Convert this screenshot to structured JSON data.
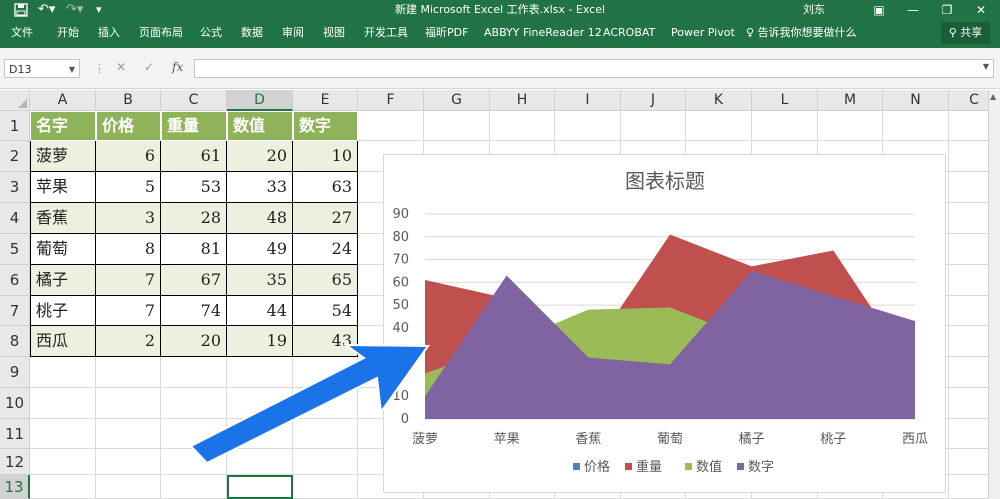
{
  "window": {
    "title": "新建 Microsoft Excel 工作表.xlsx  -  Excel",
    "user": "刘东",
    "save_icon": "save-icon",
    "undo_icon": "undo-icon",
    "redo_icon": "redo-icon",
    "minimize": "—",
    "restore": "❐",
    "close": "✕"
  },
  "ribbon": {
    "tabs": [
      "文件",
      "开始",
      "插入",
      "页面布局",
      "公式",
      "数据",
      "审阅",
      "视图",
      "开发工具",
      "福昕PDF",
      "ABBYY FineReader 12",
      "ACROBAT",
      "Power Pivot"
    ],
    "tell_me": "告诉我你想要做什么",
    "share": "共享"
  },
  "formula_bar": {
    "name_box": "D13",
    "cancel": "✕",
    "enter": "✓",
    "fx": "fx",
    "value": ""
  },
  "columns": [
    "A",
    "B",
    "C",
    "D",
    "E",
    "F",
    "G",
    "H",
    "I",
    "J",
    "K",
    "L",
    "M",
    "N",
    "C"
  ],
  "rows": [
    "1",
    "2",
    "3",
    "4",
    "5",
    "6",
    "7",
    "8",
    "9",
    "10",
    "11",
    "12",
    "13"
  ],
  "table": {
    "headers": [
      "名字",
      "价格",
      "重量",
      "数值",
      "数字"
    ],
    "rows": [
      [
        "菠萝",
        "6",
        "61",
        "20",
        "10"
      ],
      [
        "苹果",
        "5",
        "53",
        "33",
        "63"
      ],
      [
        "香蕉",
        "3",
        "28",
        "48",
        "27"
      ],
      [
        "葡萄",
        "8",
        "81",
        "49",
        "24"
      ],
      [
        "橘子",
        "7",
        "67",
        "35",
        "65"
      ],
      [
        "桃子",
        "7",
        "74",
        "44",
        "54"
      ],
      [
        "西瓜",
        "2",
        "20",
        "19",
        "43"
      ]
    ]
  },
  "chart_data": {
    "type": "area",
    "title": "图表标题",
    "categories": [
      "菠萝",
      "苹果",
      "香蕉",
      "葡萄",
      "橘子",
      "桃子",
      "西瓜"
    ],
    "ylim": [
      0,
      90
    ],
    "yticks": [
      0,
      10,
      20,
      30,
      40,
      50,
      60,
      70,
      80,
      90
    ],
    "grid": true,
    "legend_position": "bottom",
    "series": [
      {
        "name": "价格",
        "color": "#4f81bd",
        "values": [
          6,
          5,
          3,
          8,
          7,
          7,
          2
        ]
      },
      {
        "name": "重量",
        "color": "#c0504d",
        "values": [
          61,
          53,
          28,
          81,
          67,
          74,
          20
        ]
      },
      {
        "name": "数值",
        "color": "#9bbb59",
        "values": [
          20,
          33,
          48,
          49,
          35,
          44,
          19
        ]
      },
      {
        "name": "数字",
        "color": "#8064a2",
        "values": [
          10,
          63,
          27,
          24,
          65,
          54,
          43
        ]
      }
    ]
  },
  "colors": {
    "excel_green": "#217346",
    "header_fill": "#8fb35a",
    "band_fill": "#ebf1de",
    "arrow_blue": "#1a73e8"
  }
}
